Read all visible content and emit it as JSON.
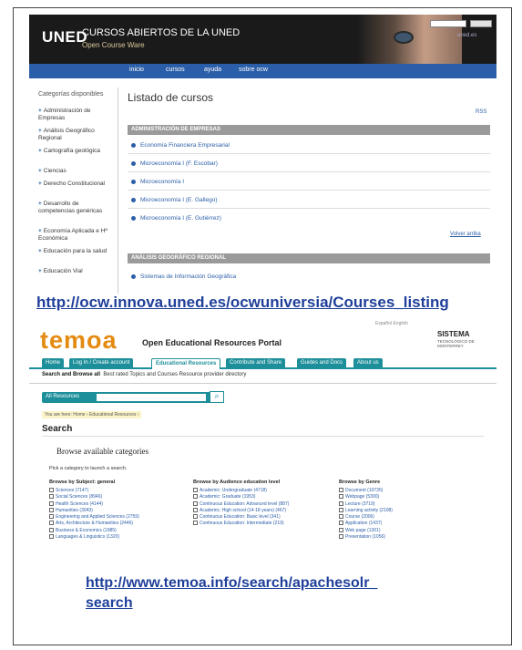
{
  "uned": {
    "logo": "UNED",
    "title": "CURSOS ABIERTOS DE LA UNED",
    "subtitle": "Open Course Ware",
    "header_link": "uned.es",
    "search_button": "Buscar",
    "nav": [
      "inicio",
      "cursos",
      "ayuda",
      "sobre ocw"
    ],
    "sidebar_title": "Categorías disponibles",
    "sidebar_items": [
      "Administración de Empresas",
      "Análisis Geográfico Regional",
      "Cartografía geológica",
      "Ciencias",
      "Derecho Constitucional",
      "Desarrollo de competencias genéricas",
      "Economía Aplicada e Hª Económica",
      "Educación para la salud",
      "Educación Vial"
    ],
    "main_title": "Listado de cursos",
    "icons_label": "RSS",
    "section1": "ADMINISTRACIÓN DE EMPRESAS",
    "courses1": [
      "Economía Financiera Empresarial",
      "Microeconomía I (F. Escobar)",
      "Microeconomía I",
      "Microeconomía I (E. Gallego)",
      "Microeconomía I (E. Gutiérrez)"
    ],
    "more_link": "Volver arriba",
    "section2": "ANÁLISIS GEOGRÁFICO REGIONAL",
    "courses2": [
      "Sistemas de Información Geográfica"
    ]
  },
  "url1": "http://ocw.innova.uned.es/ocwuniversia/Courses_listing",
  "temoa": {
    "top_links": "Español   English",
    "logo": "temoa",
    "tagline": "Open Educational Resources Portal",
    "sistema": "SISTEMA",
    "sistema_sub": "TECNOLÓGICO DE MONTERREY",
    "tabs": [
      "Home",
      "Log In / Create account",
      "Educational Resources",
      "Contribute and Share",
      "Guides and Docs",
      "About us"
    ],
    "subnav_bold": "Search and Browse all",
    "subnav_rest": "Best rated   Topics and Courses   Resource provider directory",
    "search_label": "All Resources",
    "search_icon": "magnifier",
    "breadcrumb": "You are here:  Home › Educational Resources ›",
    "heading": "Search",
    "browse_title": "Browse available categories",
    "pick_text": "Pick a category to launch a search.",
    "col1_title": "Browse by Subject: general",
    "col1_items": [
      "Sciences (7147)",
      "Social Sciences (8946)",
      "Health Sciences (4144)",
      "Humanities (3043)",
      "Engineering and Applied Sciences (2759)",
      "Arts, Architecture & Humanities (2446)",
      "Business & Economics (1985)",
      "Languages & Linguistics (1320)"
    ],
    "col2_title": "Browse by Audience education level",
    "col2_items": [
      "Academic: Undergraduate (4718)",
      "Academic: Graduate (1953)",
      "Continuous Education: Advanced level (887)",
      "Academic: High school (14-18 years) (467)",
      "Continuous Education: Basic level (341)",
      "Continuous Education: Intermediate (219)"
    ],
    "col3_title": "Browse by Genre",
    "col3_items": [
      "Document (10735)",
      "Webpage (5300)",
      "Lecture (3719)",
      "Learning activity (2108)",
      "Course (2006)",
      "Application (1437)",
      "Web page (1301)",
      "Presentation (1056)"
    ]
  },
  "url2_line1": "http://www.temoa.info/search/apachesolr_",
  "url2_line2": "search"
}
